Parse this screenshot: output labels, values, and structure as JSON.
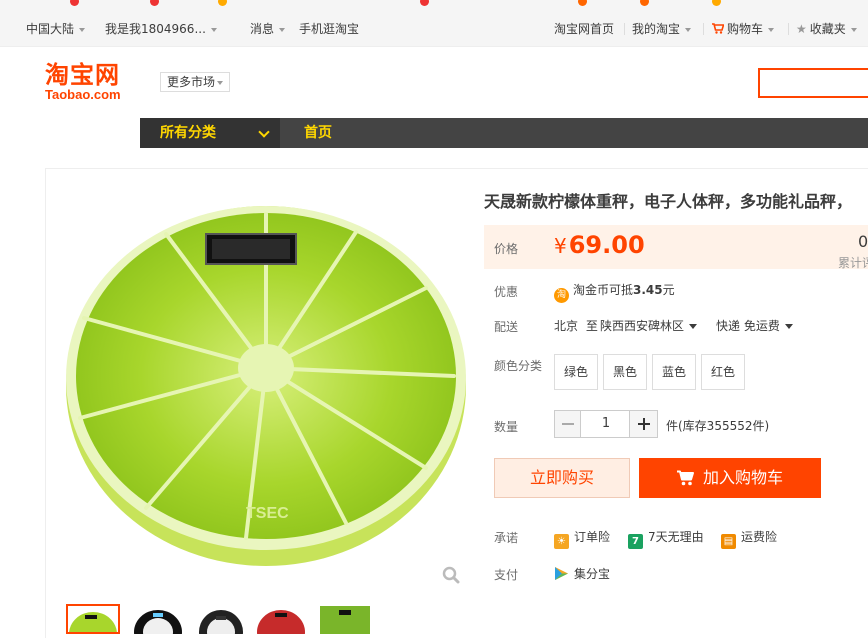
{
  "topbar": {
    "region": "中国大陆",
    "user": "我是我1804966...",
    "messages": "消息",
    "mobile": "手机逛淘宝",
    "home": "淘宝网首页",
    "my_taobao": "我的淘宝",
    "cart": "购物车",
    "favorites": "收藏夹"
  },
  "header": {
    "logo_cn": "淘宝网",
    "logo_en": "Taobao.com",
    "more_market": "更多市场"
  },
  "nav": {
    "all_categories": "所有分类",
    "home": "首页"
  },
  "product": {
    "title": "天晟新款柠檬体重秤，电子人体秤，多功能礼品秤，",
    "brand_on_image": "TSEC",
    "price_label": "价格",
    "currency": "¥",
    "price": "69.00",
    "sales_count": "0",
    "sales_label": "累计评",
    "promo_label": "优惠",
    "coin_icon_text": "淘",
    "promo_text": "淘金币可抵",
    "promo_amount": "3.45",
    "promo_unit": "元",
    "delivery_label": "配送",
    "delivery_from": "北京",
    "delivery_to_word": "至",
    "delivery_to": "陕西西安碑林区",
    "shipping": "快递 免运费",
    "color_label": "颜色分类",
    "colors": [
      "绿色",
      "黑色",
      "蓝色",
      "红色"
    ],
    "qty_label": "数量",
    "qty": "1",
    "stock_text": "件(库存355552件)",
    "buy_now": "立即购买",
    "add_to_cart": "加入购物车",
    "promise_label": "承诺",
    "promises": [
      "订单险",
      "7天无理由",
      "运费险"
    ],
    "promise_badge_7": "7",
    "payment_label": "支付",
    "payment": "集分宝"
  },
  "colors": {
    "accent": "#ff4400",
    "nav_bg": "#444444",
    "nav_text": "#ffd700",
    "lemon": "#9acd1e"
  }
}
